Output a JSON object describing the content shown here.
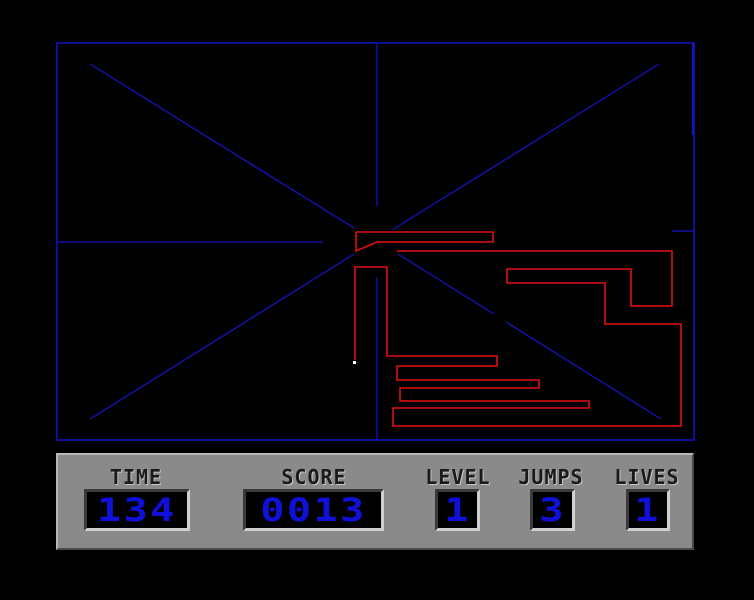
{
  "colors": {
    "wireframe": "#1414c8",
    "track": "#e01010",
    "hud_panel": "#8a8a8a",
    "hud_digits": "#1010d8",
    "background": "#000000"
  },
  "hud": {
    "time": {
      "label": "TIME",
      "value": "134"
    },
    "score": {
      "label": "SCORE",
      "value": "0013"
    },
    "level": {
      "label": "LEVEL",
      "value": "1"
    },
    "jumps": {
      "label": "JUMPS",
      "value": "3"
    },
    "lives": {
      "label": "LIVES",
      "value": "1"
    }
  }
}
